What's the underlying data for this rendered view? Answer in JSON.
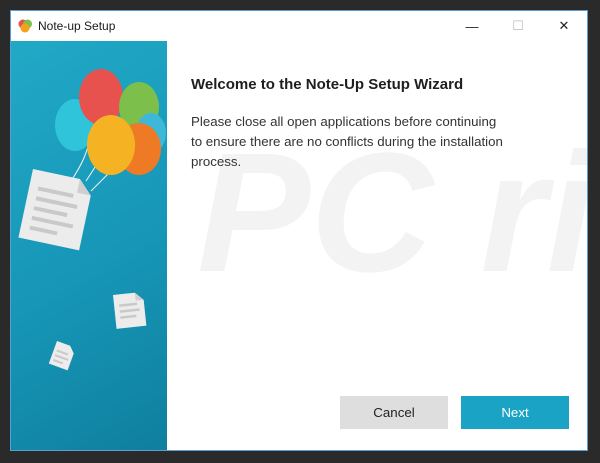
{
  "window": {
    "title": "Note-up Setup",
    "controls": {
      "minimize": "—",
      "maximize": "☐",
      "close": "✕"
    }
  },
  "main": {
    "heading": "Welcome to the Note-Up Setup Wizard",
    "message": "Please close all open applications before continuing to ensure there are no conflicts during the installation process.",
    "watermark_text": "PC risk.com"
  },
  "buttons": {
    "cancel_label": "Cancel",
    "next_label": "Next"
  },
  "colors": {
    "accent": "#1ba3c6",
    "sidebar": "#1796b7",
    "cancel_bg": "#dedede"
  },
  "icons": {
    "app": "balloon-icon",
    "sidebar_art": "balloons-and-documents-illustration"
  }
}
